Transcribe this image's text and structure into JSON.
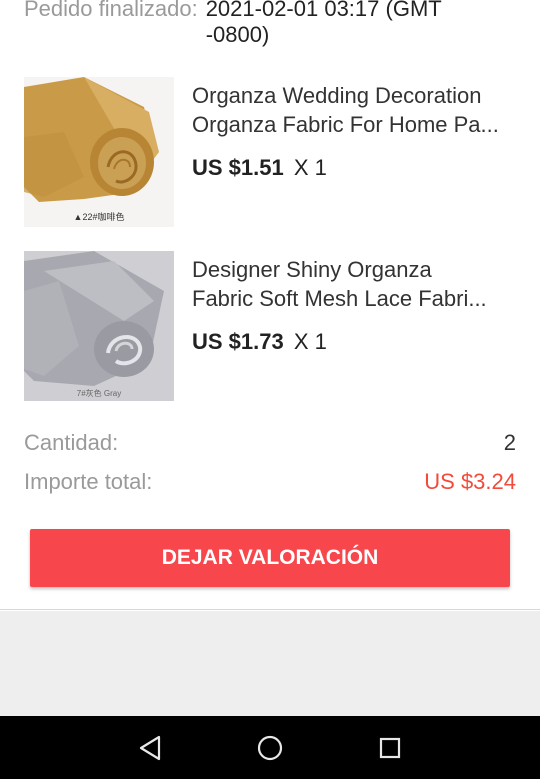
{
  "order": {
    "status_label": "Pedido finalizado:",
    "status_value": "2021-02-01 03:17 (GMT -0800)"
  },
  "items": [
    {
      "title_line1": "Organza Wedding Decoration",
      "title_line2": "Organza Fabric For Home Pa...",
      "price": "US $1.51",
      "quantity": "X 1",
      "image_caption": "▲22#咖啡色",
      "image_icon": "beige-fabric-roll-image"
    },
    {
      "title_line1": "Designer Shiny Organza",
      "title_line2": "Fabric Soft Mesh Lace Fabri...",
      "price": "US $1.73",
      "quantity": "X 1",
      "image_caption": "7#灰色 Gray",
      "image_icon": "gray-fabric-roll-image"
    }
  ],
  "summary": {
    "quantity_label": "Cantidad:",
    "quantity_value": "2",
    "total_label": "Importe total:",
    "total_value": "US $3.24"
  },
  "actions": {
    "review_button_label": "DEJAR VALORACIÓN"
  },
  "colors": {
    "accent": "#f7474d",
    "total_price": "#f24a3b"
  },
  "navbar": {
    "icons": [
      "back-triangle-icon",
      "home-circle-icon",
      "recents-square-icon"
    ]
  }
}
